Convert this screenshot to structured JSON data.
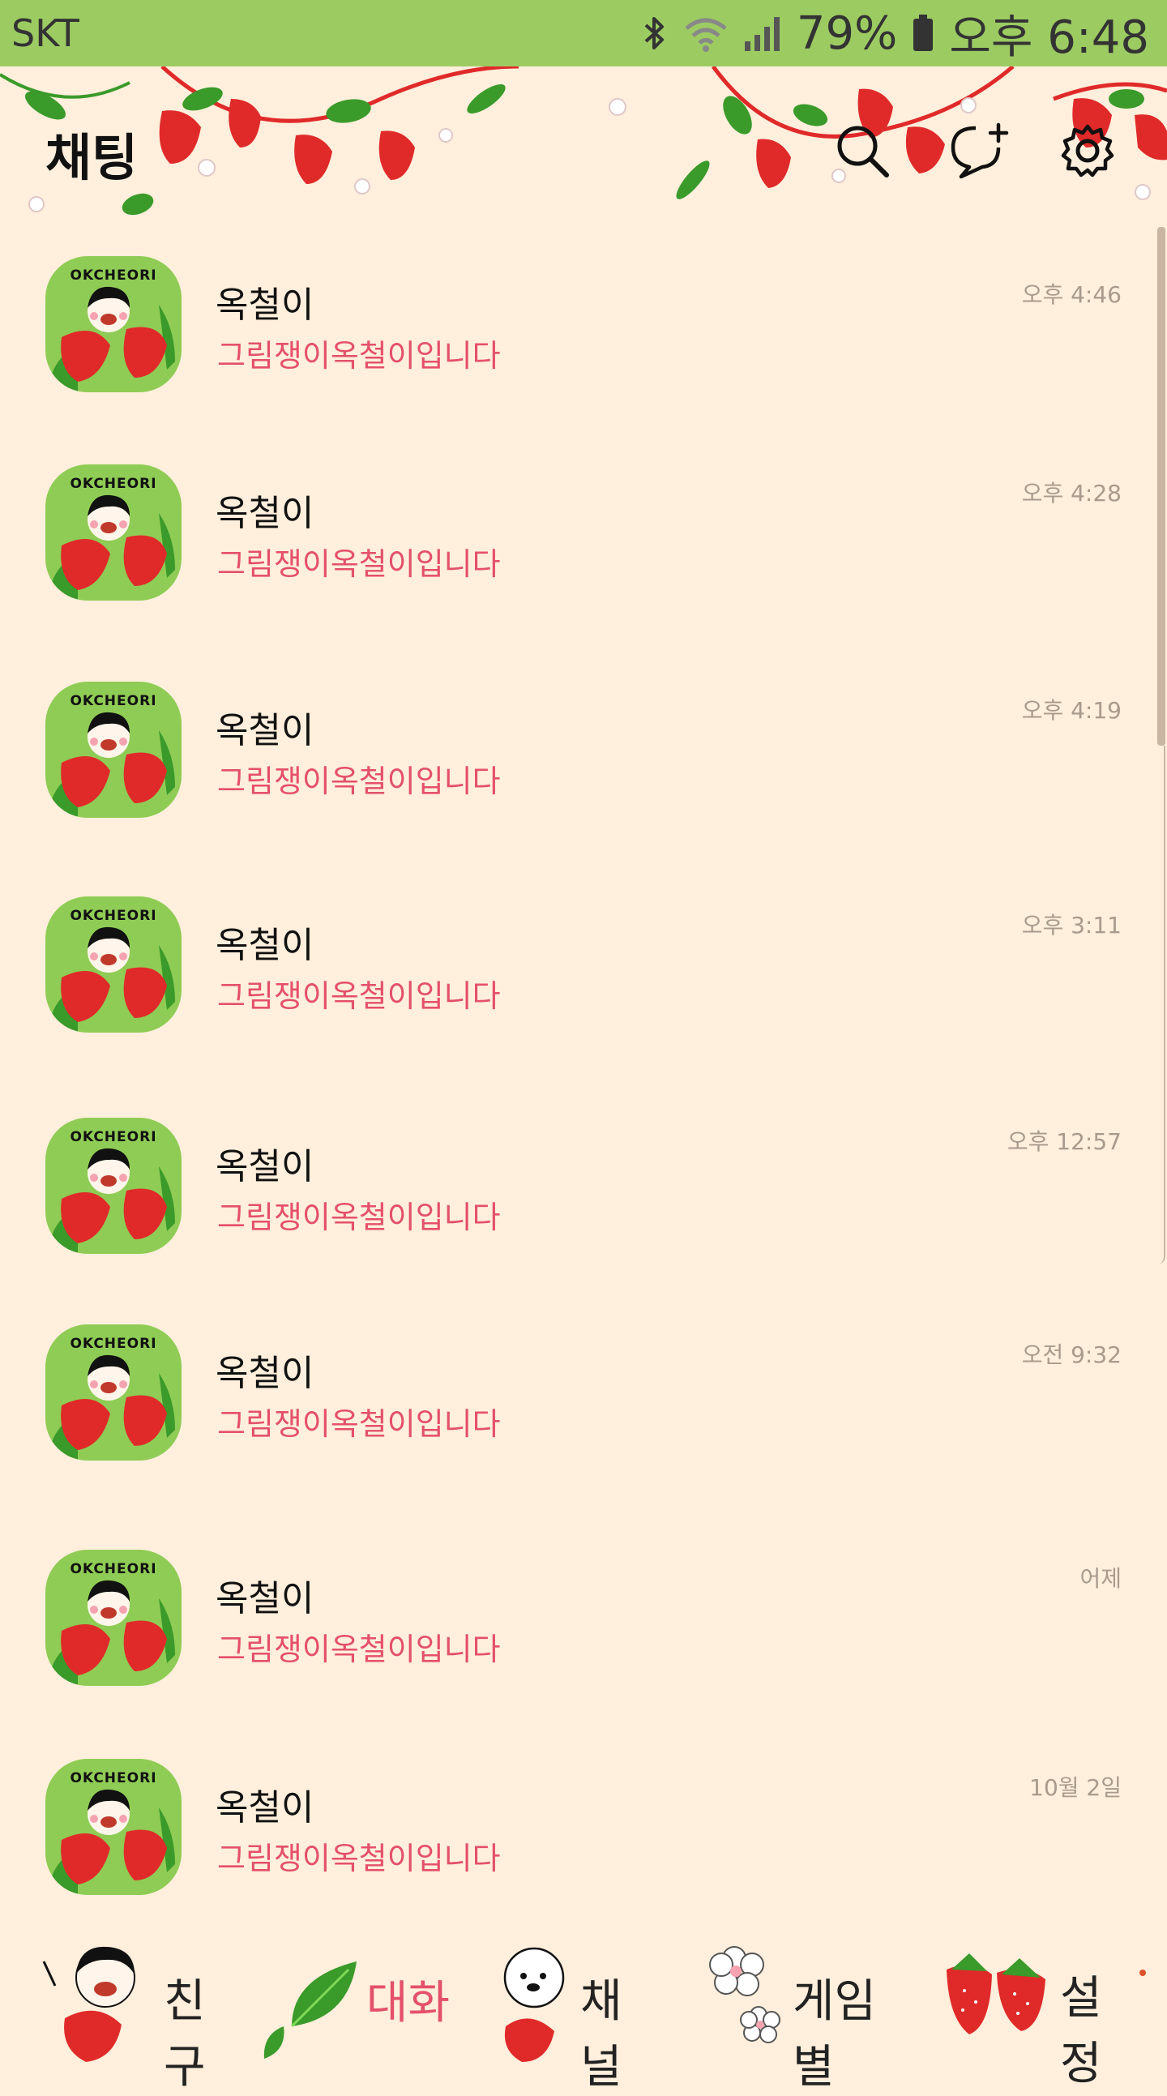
{
  "status_bar": {
    "carrier": "SKT",
    "battery": "79%",
    "time": "오후 6:48"
  },
  "header": {
    "title": "채팅",
    "icons": [
      "search-icon",
      "new-chat-icon",
      "gear-icon"
    ]
  },
  "chats": [
    {
      "name": "옥철이",
      "message": "그림쟁이옥철이입니다",
      "time": "오후 4:46",
      "avatar_text": "OKCHEORI"
    },
    {
      "name": "옥철이",
      "message": "그림쟁이옥철이입니다",
      "time": "오후 4:28",
      "avatar_text": "OKCHEORI"
    },
    {
      "name": "옥철이",
      "message": "그림쟁이옥철이입니다",
      "time": "오후 4:19",
      "avatar_text": "OKCHEORI"
    },
    {
      "name": "옥철이",
      "message": "그림쟁이옥철이입니다",
      "time": "오후 3:11",
      "avatar_text": "OKCHEORI"
    },
    {
      "name": "옥철이",
      "message": "그림쟁이옥철이입니다",
      "time": "오후 12:57",
      "avatar_text": "OKCHEORI"
    },
    {
      "name": "옥철이",
      "message": "그림쟁이옥철이입니다",
      "time": "오전 9:32",
      "avatar_text": "OKCHEORI"
    },
    {
      "name": "옥철이",
      "message": "그림쟁이옥철이입니다",
      "time": "어제",
      "avatar_text": "OKCHEORI"
    },
    {
      "name": "옥철이",
      "message": "그림쟁이옥철이입니다",
      "time": "10월 2일",
      "avatar_text": "OKCHEORI"
    }
  ],
  "tabs": [
    {
      "label": "친구",
      "active": false
    },
    {
      "label": "대화",
      "active": true
    },
    {
      "label": "채널",
      "active": false
    },
    {
      "label": "게임별",
      "active": false
    },
    {
      "label": "설정",
      "active": false
    }
  ],
  "colors": {
    "status_bar": "#9ccb62",
    "background": "#ffefdc",
    "message_text": "#e4506a",
    "time_text": "#a89a8c",
    "strawberry": "#e02a2a",
    "leaf": "#3a9a2a"
  }
}
